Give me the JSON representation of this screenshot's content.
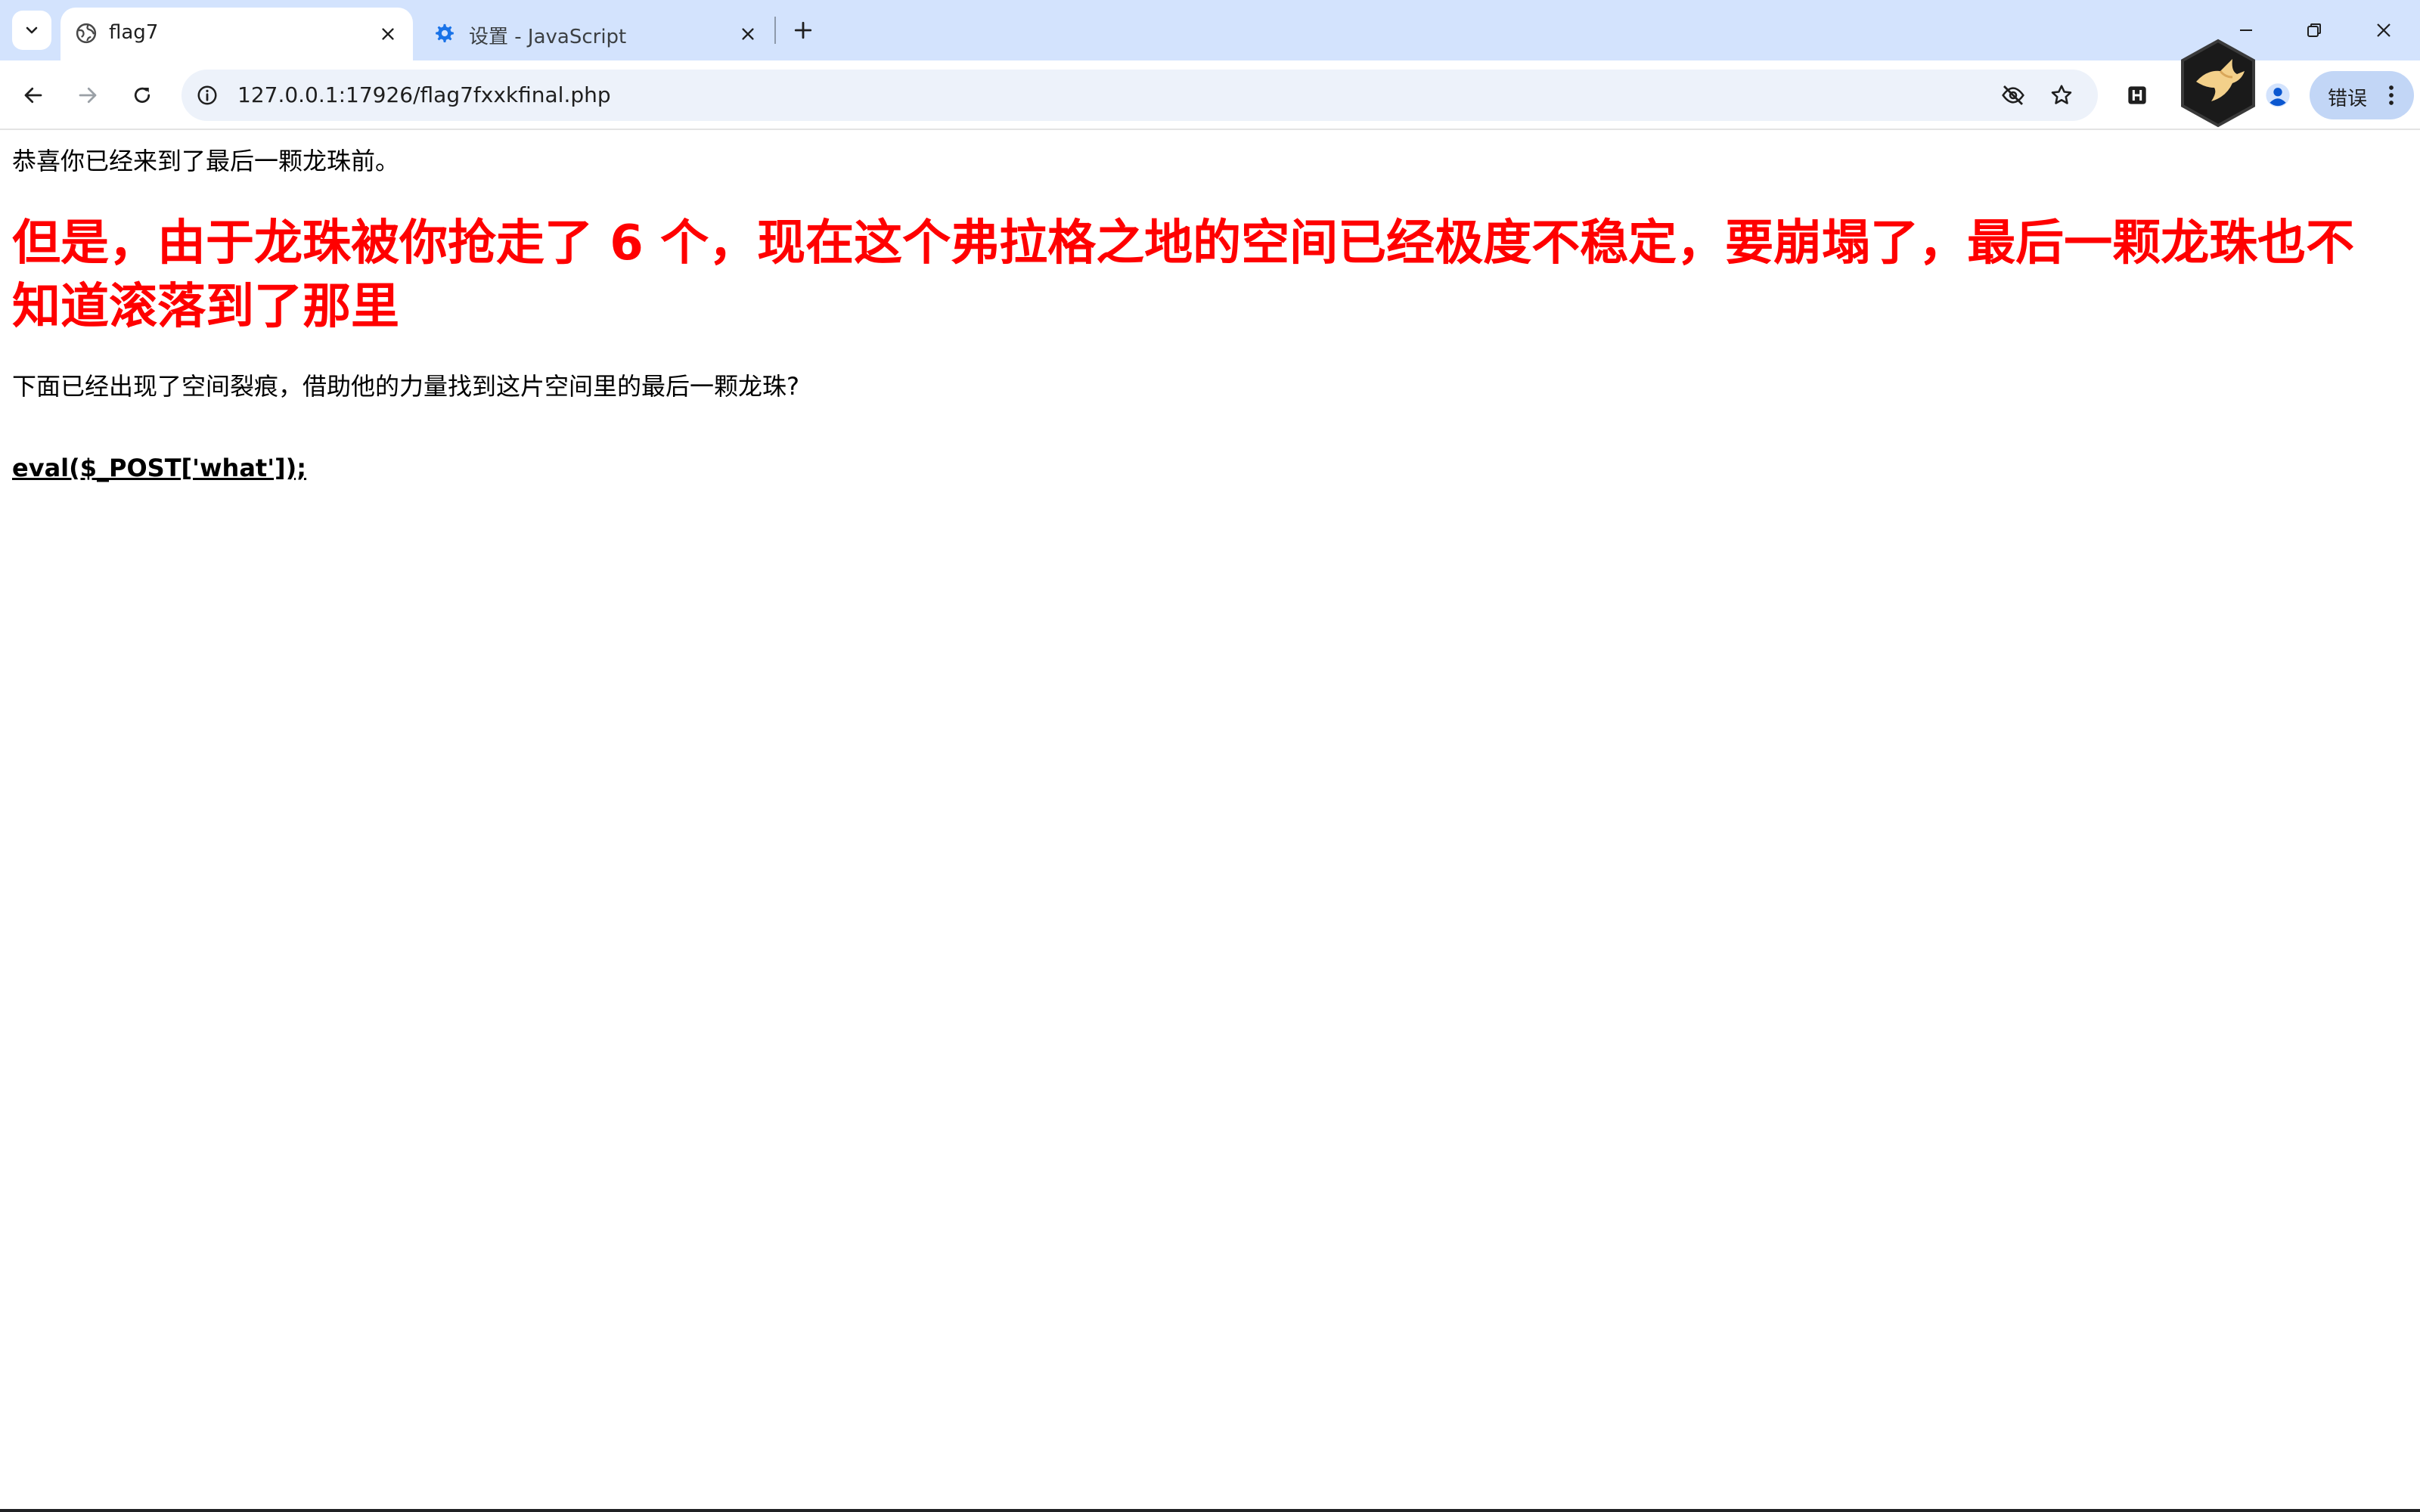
{
  "browser": {
    "tabs": [
      {
        "title": "flag7",
        "icon": "globe-icon",
        "active": true
      },
      {
        "title": "设置 - JavaScript",
        "icon": "gear-icon",
        "active": false
      }
    ],
    "address_bar": {
      "url": "127.0.0.1:17926/flag7fxxkfinal.php"
    },
    "error_chip": {
      "label": "错误"
    },
    "colors": {
      "tabstrip_bg": "#d3e3fd",
      "omnibox_bg": "#edf2fa",
      "accent": "#0b57d0"
    }
  },
  "page": {
    "intro": "恭喜你已经来到了最后一颗龙珠前。",
    "headline": "但是，由于龙珠被你抢走了 6 个，现在这个弗拉格之地的空间已经极度不稳定，要崩塌了，最后一颗龙珠也不知道滚落到了那里",
    "hint": "下面已经出现了空间裂痕，借助他的力量找到这片空间里的最后一颗龙珠?",
    "code_link": "eval($_POST['what']);",
    "colors": {
      "headline": "#ff0000",
      "text": "#000000"
    }
  }
}
